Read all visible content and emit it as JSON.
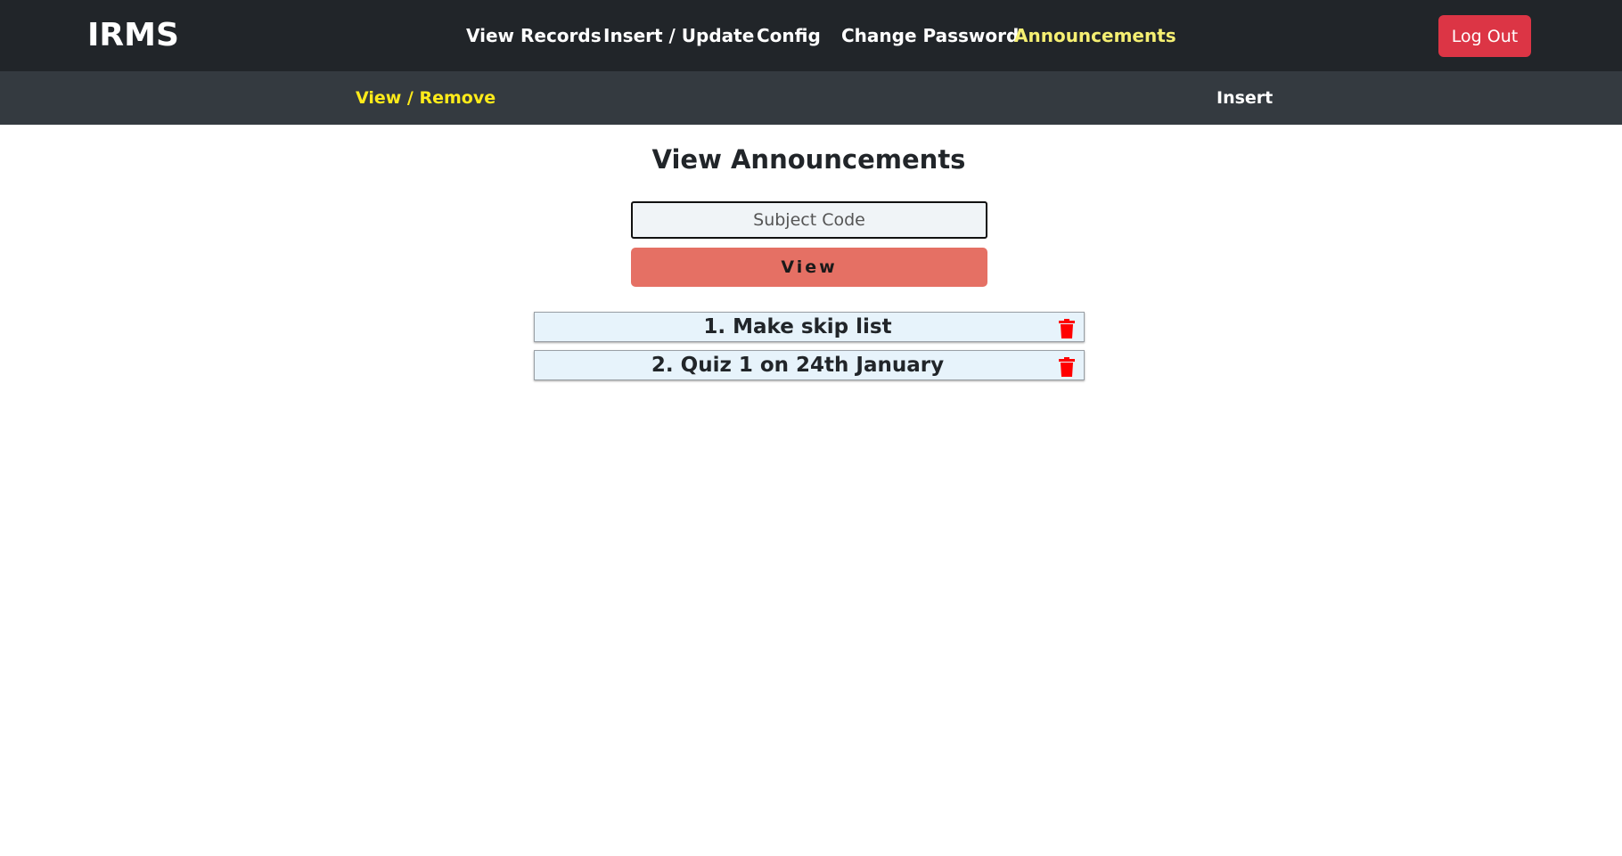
{
  "brand": "IRMS",
  "nav": {
    "items": [
      {
        "label": "View Records"
      },
      {
        "label": "Insert / Update"
      },
      {
        "label": "Config"
      },
      {
        "label": "Change Password"
      },
      {
        "label": "Announcements"
      }
    ],
    "active": "Announcements",
    "logout_label": "Log Out"
  },
  "subnav": {
    "items": [
      {
        "label": "View / Remove"
      },
      {
        "label": "Insert"
      }
    ],
    "active": "View / Remove"
  },
  "main": {
    "title": "View Announcements",
    "subject_input": {
      "placeholder": "Subject Code",
      "value": ""
    },
    "view_button_label": "View",
    "announcements": [
      {
        "text": "1. Make skip list",
        "icon": "trash-icon"
      },
      {
        "text": "2. Quiz 1 on 24th January",
        "icon": "trash-icon"
      }
    ]
  },
  "colors": {
    "navbar": "#212529",
    "subbar": "#343a40",
    "active_nav": "#f5ef72",
    "active_subnav": "#ffeb1a",
    "logout": "#dc3545",
    "view_button": "#e57064",
    "announcement_bg": "#e7f3fb",
    "trash": "#ff0000"
  }
}
